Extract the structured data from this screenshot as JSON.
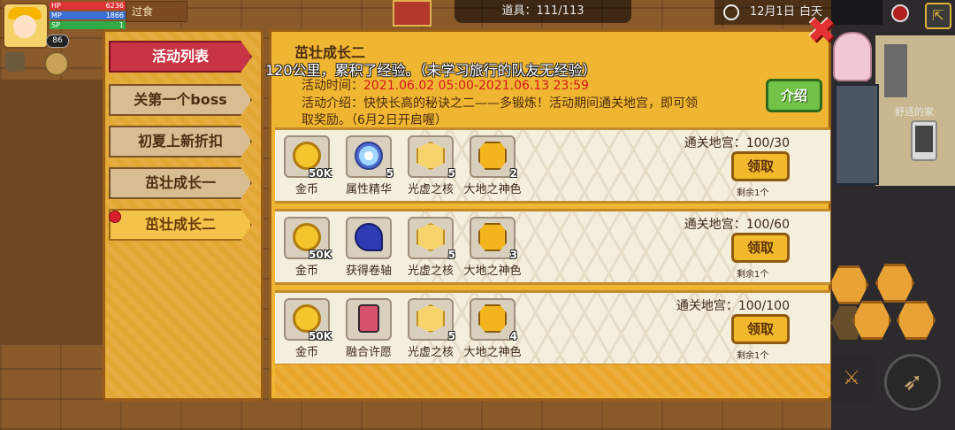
{
  "hud": {
    "hp_label": "HP",
    "hp_value": "6236",
    "mp_label": "MP",
    "mp_value": "1866",
    "sp_label": "SP",
    "sp_value": "1",
    "level": "86",
    "tag": "过食",
    "items_label": "道具：111/113",
    "date": "12月1日",
    "daytime": "白天",
    "cozy_home": "舒适的家"
  },
  "tabs": [
    {
      "label": "活动列表"
    },
    {
      "label": "关第一个boss"
    },
    {
      "label": "初夏上新折扣"
    },
    {
      "label": "茁壮成长一"
    },
    {
      "label": "茁壮成长二"
    }
  ],
  "event": {
    "title": "茁壮成长二",
    "tip": "120公里，累积了经验。（未学习旅行的队友无经验）",
    "time_label": "活动时间：",
    "time_value": "2021.06.02 05:00-2021.06.13 23:59",
    "desc_line1": "活动介绍：快快长高的秘诀之二——多锻炼！活动期间通关地宫，即可领",
    "desc_line2": "取奖励。（6月2日开启喔）",
    "intro_button": "介绍"
  },
  "rewards": [
    {
      "requirement": "通关地宫：100/30",
      "claim_label": "领取",
      "remaining": "剩余1个",
      "items": [
        {
          "name": "金币",
          "count": "50K",
          "icon": "coin"
        },
        {
          "name": "属性精华",
          "count": "5",
          "icon": "essence"
        },
        {
          "name": "光虚之核",
          "count": "5",
          "icon": "core"
        },
        {
          "name": "大地之神色",
          "count": "2",
          "icon": "earth"
        }
      ]
    },
    {
      "requirement": "通关地宫：100/60",
      "claim_label": "领取",
      "remaining": "剩余1个",
      "items": [
        {
          "name": "金币",
          "count": "50K",
          "icon": "coin"
        },
        {
          "name": "获得卷轴",
          "count": "",
          "icon": "scroll"
        },
        {
          "name": "光虚之核",
          "count": "5",
          "icon": "core"
        },
        {
          "name": "大地之神色",
          "count": "3",
          "icon": "earth"
        }
      ]
    },
    {
      "requirement": "通关地宫：100/100",
      "claim_label": "领取",
      "remaining": "剩余1个",
      "items": [
        {
          "name": "金币",
          "count": "50K",
          "icon": "coin"
        },
        {
          "name": "融合许愿",
          "count": "",
          "icon": "bottle"
        },
        {
          "name": "光虚之核",
          "count": "5",
          "icon": "core"
        },
        {
          "name": "大地之神色",
          "count": "4",
          "icon": "earth"
        }
      ]
    }
  ]
}
